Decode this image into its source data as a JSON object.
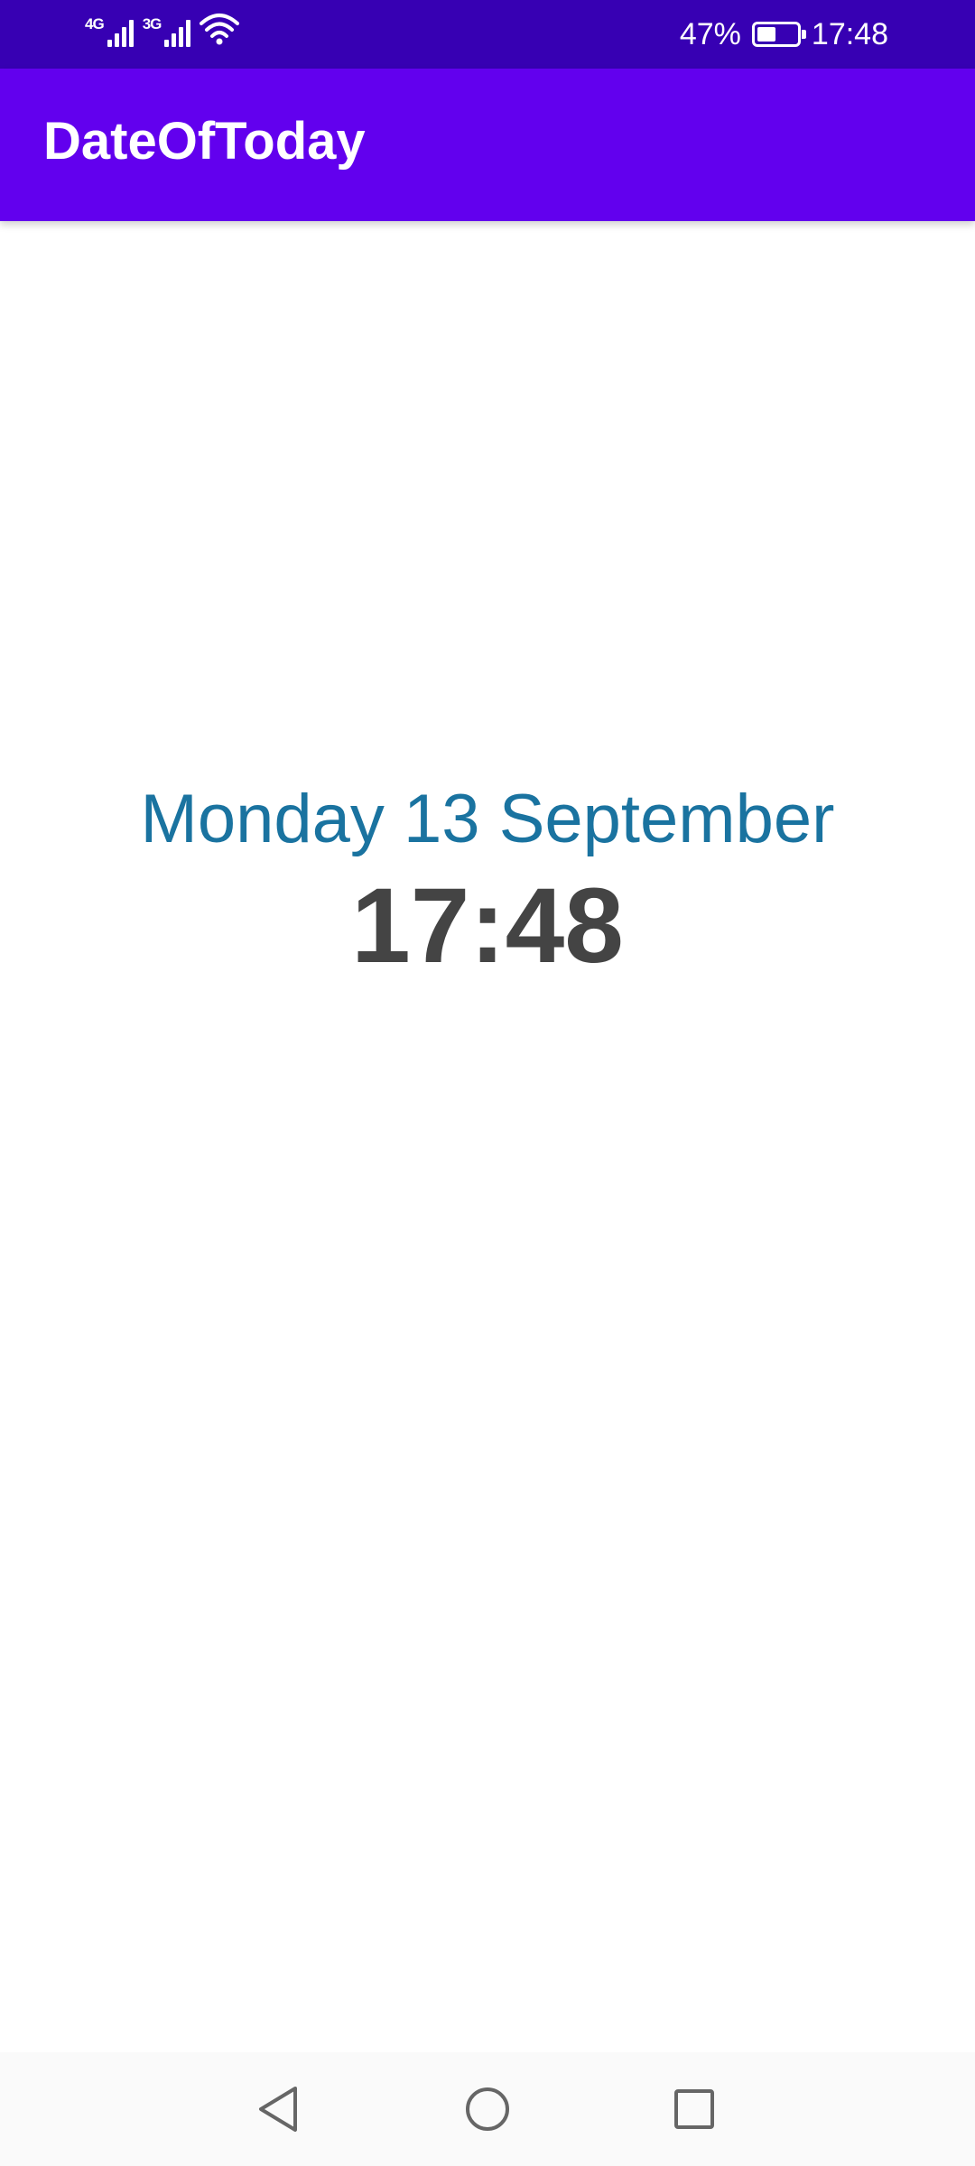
{
  "status_bar": {
    "network_1": "4G",
    "network_2": "3G",
    "battery_percent": "47%",
    "battery_level": 0.47,
    "time": "17:48",
    "icons": [
      "signal-icon",
      "signal-icon",
      "wifi-icon",
      "battery-icon"
    ]
  },
  "app_bar": {
    "title": "DateOfToday"
  },
  "main": {
    "date": "Monday 13 September",
    "time": "17:48"
  },
  "nav_bar": {
    "icons": [
      "back-icon",
      "home-icon",
      "recents-icon"
    ]
  },
  "colors": {
    "status_bar": "#3700b3",
    "app_bar": "#6200ee",
    "date_text": "#1a73a0",
    "time_text": "#444444"
  }
}
